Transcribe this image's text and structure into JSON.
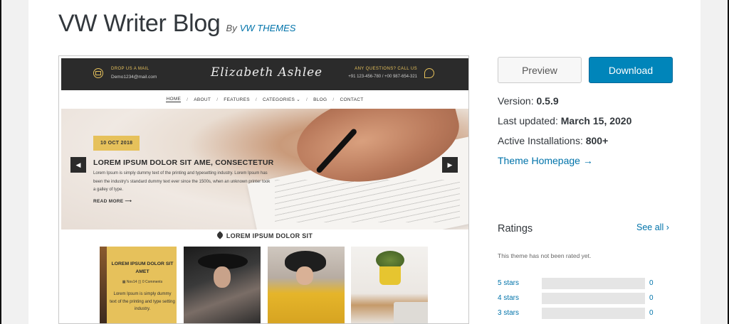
{
  "theme": {
    "title": "VW Writer Blog",
    "by": "By",
    "author": "VW THEMES"
  },
  "preview_site": {
    "drop_label": "DROP US A MAIL",
    "drop_value": "Demo1234@mail.com",
    "site_name": "Elizabeth Ashlee",
    "questions_label": "ANY QUESTIONS? CALL US",
    "questions_value": "+91 123-456-780 / +00 987-654-321",
    "nav": [
      "HOME",
      "ABOUT",
      "FEATURES",
      "CATEGORIES ⌄",
      "BLOG",
      "CONTACT"
    ],
    "hero": {
      "date": "10 OCT 2018",
      "title": "LOREM IPSUM DOLOR SIT AME, CONSECTETUR",
      "text": "Lorem Ipsum is simply dummy text of the printing and typesetting industry. Lorem Ipsum has been the industry's standard dummy text ever since the 1500s, when an unknown printer took a galley of type.",
      "read_more": "READ MORE  ⟶",
      "prev": "◀",
      "next": "▶"
    },
    "section_title": "LOREM IPSUM DOLOR SIT",
    "post": {
      "title": "LOREM IPSUM DOLOR SIT AMET",
      "meta": "▦ Nov14   ◫ 0 Comments",
      "text": "Lorem Ipsum is simply dummy text of the printing and type setting industry."
    }
  },
  "actions": {
    "preview": "Preview",
    "download": "Download"
  },
  "meta": {
    "version_label": "Version: ",
    "version": "0.5.9",
    "updated_label": "Last updated: ",
    "updated": "March 15, 2020",
    "installs_label": "Active Installations: ",
    "installs": "800+",
    "homepage": "Theme Homepage →"
  },
  "ratings": {
    "heading": "Ratings",
    "see_all": "See all ›",
    "not_rated": "This theme has not been rated yet.",
    "rows": [
      {
        "label": "5 stars",
        "count": "0",
        "fraction": 0
      },
      {
        "label": "4 stars",
        "count": "0",
        "fraction": 0
      },
      {
        "label": "3 stars",
        "count": "0",
        "fraction": 0
      }
    ]
  },
  "colors": {
    "accent": "#0073aa",
    "download_bg": "#0085ba",
    "preview_yellow": "#e6c15b"
  }
}
